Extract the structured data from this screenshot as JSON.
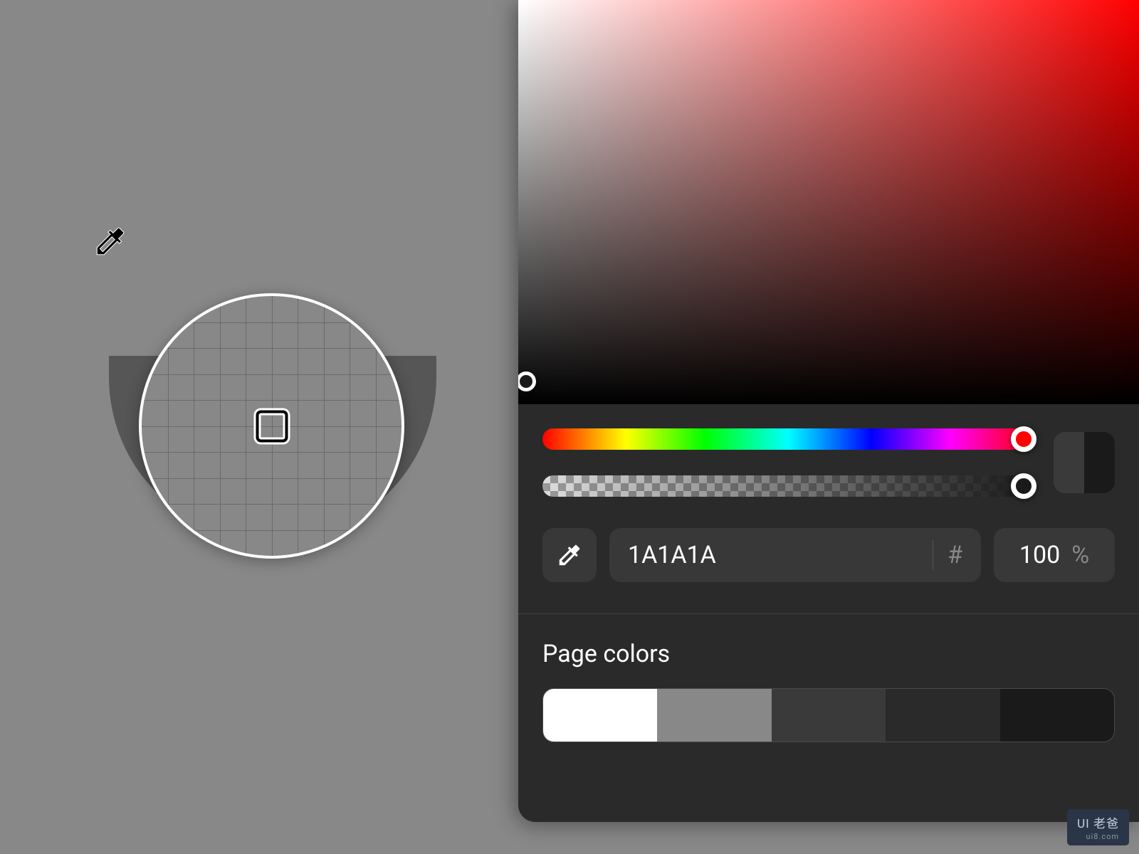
{
  "color_input": {
    "hex_value": "1A1A1A",
    "hex_format_label": "#",
    "opacity_value": "100",
    "opacity_unit": "%"
  },
  "page_colors": {
    "title": "Page colors",
    "swatches": [
      "#ffffff",
      "#888888",
      "#3a3a3a",
      "#2a2a2a",
      "#1a1a1a"
    ]
  },
  "color_preview": {
    "old": "#3a3a3a",
    "new": "#1a1a1a"
  },
  "watermark": {
    "main": "UI 老爸",
    "sub": "ui8.com"
  }
}
